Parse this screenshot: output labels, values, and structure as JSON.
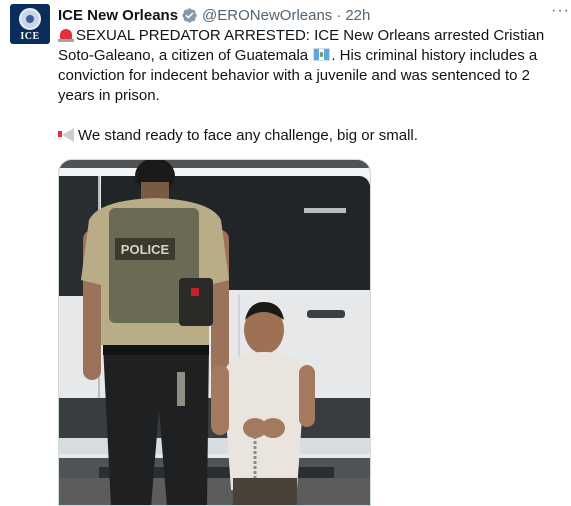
{
  "account": {
    "name": "ICE New Orleans",
    "handle": "@ERONewOrleans",
    "separator": "·",
    "time": "22h",
    "avatar_text": "ICE",
    "verified_icon": "verified-badge-icon"
  },
  "post": {
    "line1_prefix": "SEXUAL PREDATOR ARRESTED: ICE New Orleans arrested Cristian Soto-Galeano, a citizen of Guatemala ",
    "line1_suffix": ". His criminal history includes a conviction for indecent behavior with a juvenile and was sentenced to 2 years in prison.",
    "line2": "We stand ready to face any challenge, big or small.",
    "emoji": {
      "siren": "police-car-light-icon",
      "flag": "guatemala-flag-icon",
      "megaphone": "megaphone-icon"
    }
  },
  "media": {
    "vest_label": "POLICE"
  },
  "more_menu": "···",
  "colors": {
    "text": "#0f1419",
    "secondary": "#536471",
    "verified": "#829aab",
    "avatar_bg": "#0b2d5c"
  }
}
